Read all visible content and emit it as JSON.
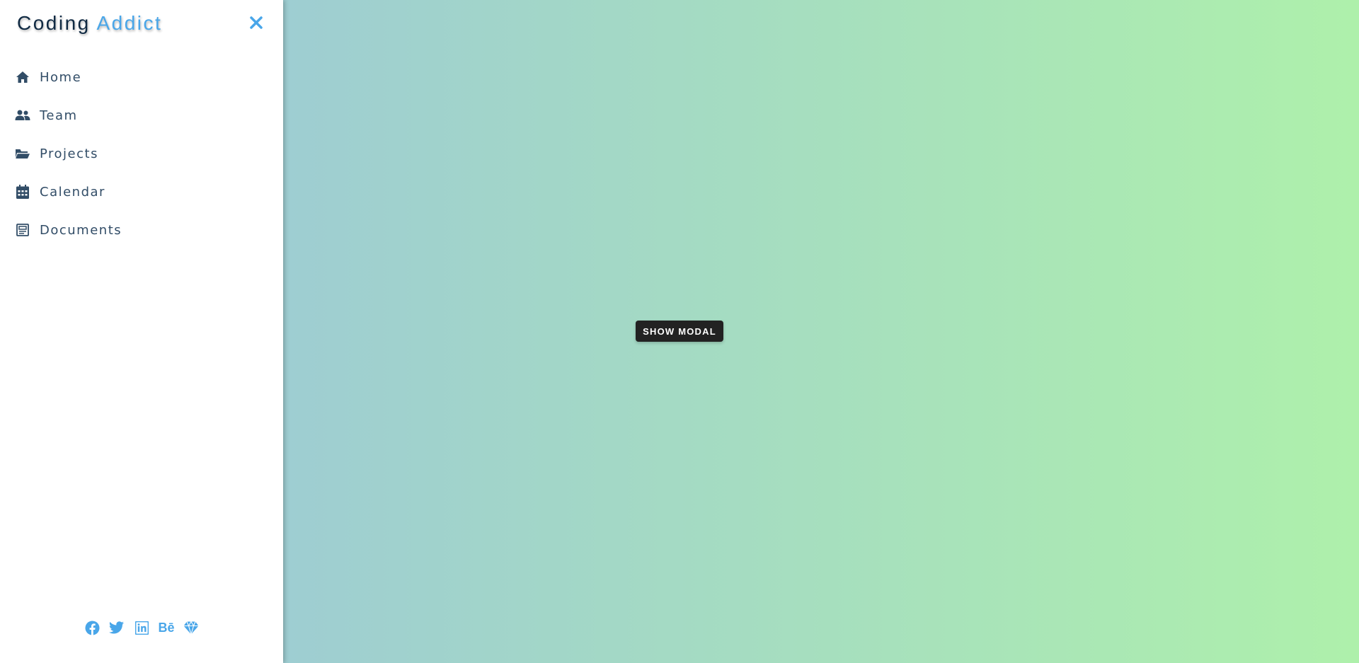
{
  "logo": {
    "part1": "Coding",
    "part2": "Addict"
  },
  "nav": [
    {
      "label": "Home",
      "icon": "home-icon"
    },
    {
      "label": "Team",
      "icon": "users-icon"
    },
    {
      "label": "Projects",
      "icon": "folder-open-icon"
    },
    {
      "label": "Calendar",
      "icon": "calendar-icon"
    },
    {
      "label": "Documents",
      "icon": "document-icon"
    }
  ],
  "social": [
    {
      "icon": "facebook-icon"
    },
    {
      "icon": "twitter-icon"
    },
    {
      "icon": "linkedin-icon"
    },
    {
      "icon": "behance-icon",
      "text": "Bē"
    },
    {
      "icon": "sketch-icon"
    }
  ],
  "main": {
    "button_label": "SHOW MODAL"
  },
  "colors": {
    "accent": "#49a6e9",
    "nav_text": "#324d67",
    "close": "#49a6e9",
    "button_bg": "#222222",
    "bg_gradient_start": "#9ac4dc",
    "bg_gradient_end": "#aef0ab"
  }
}
